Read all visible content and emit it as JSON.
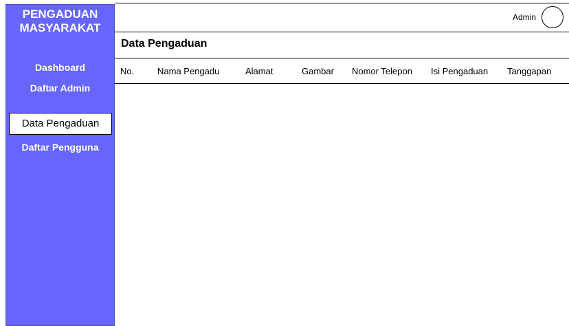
{
  "sidebar": {
    "brand": "PENGADUAN\nMASYARAKAT",
    "brand_line1": "PENGADUAN",
    "brand_line2": "MASYARAKAT",
    "items": [
      {
        "label": "Dashboard"
      },
      {
        "label": "Daftar Admin"
      },
      {
        "label": "Data Pengaduan",
        "active": true
      },
      {
        "label": "Daftar Pengguna"
      }
    ]
  },
  "header": {
    "user_label": "Admin"
  },
  "main": {
    "title": "Data Pengaduan",
    "columns": [
      "No.",
      "Nama Pengadu",
      "Alamat",
      "Gambar",
      "Nomor Telepon",
      "Isi Pengaduan",
      "Tanggapan"
    ]
  },
  "colors": {
    "sidebar_bg": "#6666ff",
    "sidebar_text": "#ffffff",
    "active_bg": "#ffffff"
  }
}
